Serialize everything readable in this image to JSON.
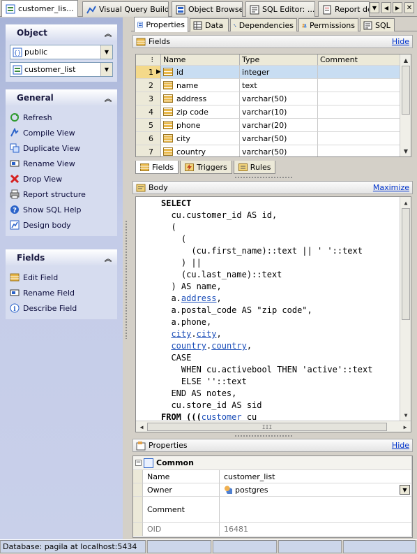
{
  "doc_tabs": [
    {
      "label": "customer_lis...",
      "icon": "view-icon",
      "active": true
    },
    {
      "label": "Visual Query Builder",
      "icon": "query-builder-icon",
      "active": false
    },
    {
      "label": "Object Browser",
      "icon": "object-browser-icon",
      "active": false
    },
    {
      "label": "SQL Editor: ...",
      "icon": "sql-editor-icon",
      "active": false
    },
    {
      "label": "Report des",
      "icon": "report-icon",
      "active": false
    }
  ],
  "left": {
    "object": {
      "title": "Object",
      "schema": "public",
      "view": "customer_list"
    },
    "general": {
      "title": "General",
      "items": [
        "Refresh",
        "Compile View",
        "Duplicate View",
        "Rename View",
        "Drop View",
        "Report structure",
        "Show SQL Help",
        "Design body"
      ]
    },
    "fields": {
      "title": "Fields",
      "items": [
        "Edit Field",
        "Rename Field",
        "Describe Field"
      ]
    }
  },
  "subtabs": [
    "Properties",
    "Data",
    "Dependencies",
    "Permissions",
    "SQL"
  ],
  "fields_section": {
    "title": "Fields",
    "hide_label": "Hide",
    "columns": [
      "Name",
      "Type",
      "Comment"
    ],
    "rows": [
      {
        "num": "1",
        "name": "id",
        "type": "integer",
        "comment": ""
      },
      {
        "num": "2",
        "name": "name",
        "type": "text",
        "comment": ""
      },
      {
        "num": "3",
        "name": "address",
        "type": "varchar(50)",
        "comment": ""
      },
      {
        "num": "4",
        "name": "zip code",
        "type": "varchar(10)",
        "comment": ""
      },
      {
        "num": "5",
        "name": "phone",
        "type": "varchar(20)",
        "comment": ""
      },
      {
        "num": "6",
        "name": "city",
        "type": "varchar(50)",
        "comment": ""
      },
      {
        "num": "7",
        "name": "country",
        "type": "varchar(50)",
        "comment": ""
      }
    ],
    "tabs": [
      "Fields",
      "Triggers",
      "Rules"
    ]
  },
  "body_section": {
    "title": "Body",
    "maximize_label": "Maximize",
    "lines": [
      [
        {
          "t": "SELECT",
          "c": "kw"
        }
      ],
      [
        {
          "t": "  cu.customer_id AS id,",
          "c": ""
        }
      ],
      [
        {
          "t": "  (",
          "c": ""
        }
      ],
      [
        {
          "t": "    (",
          "c": ""
        }
      ],
      [
        {
          "t": "      (cu.first_name)::text || ' '::text",
          "c": ""
        }
      ],
      [
        {
          "t": "    ) ||",
          "c": ""
        }
      ],
      [
        {
          "t": "    (cu.last_name)::text",
          "c": ""
        }
      ],
      [
        {
          "t": "  ) AS name,",
          "c": ""
        }
      ],
      [
        {
          "t": "  a.",
          "c": ""
        },
        {
          "t": "address",
          "c": "lnk"
        },
        {
          "t": ",",
          "c": ""
        }
      ],
      [
        {
          "t": "  a.postal_code AS \"zip code\",",
          "c": ""
        }
      ],
      [
        {
          "t": "  a.phone,",
          "c": ""
        }
      ],
      [
        {
          "t": "  ",
          "c": ""
        },
        {
          "t": "city",
          "c": "lnk"
        },
        {
          "t": ".",
          "c": ""
        },
        {
          "t": "city",
          "c": "lnk"
        },
        {
          "t": ",",
          "c": ""
        }
      ],
      [
        {
          "t": "  ",
          "c": ""
        },
        {
          "t": "country",
          "c": "lnk"
        },
        {
          "t": ".",
          "c": ""
        },
        {
          "t": "country",
          "c": "lnk"
        },
        {
          "t": ",",
          "c": ""
        }
      ],
      [
        {
          "t": "  CASE",
          "c": ""
        }
      ],
      [
        {
          "t": "    WHEN cu.activebool THEN 'active'::text",
          "c": ""
        }
      ],
      [
        {
          "t": "    ELSE ''::text",
          "c": ""
        }
      ],
      [
        {
          "t": "  END AS notes,",
          "c": ""
        }
      ],
      [
        {
          "t": "  cu.store_id AS sid",
          "c": ""
        }
      ],
      [
        {
          "t": "FROM (((",
          "c": "kw"
        },
        {
          "t": "customer",
          "c": "lnk"
        },
        {
          "t": " cu",
          "c": ""
        }
      ]
    ]
  },
  "properties_section": {
    "title": "Properties",
    "hide_label": "Hide",
    "group": "Common",
    "rows": [
      {
        "label": "Name",
        "value": "customer_list"
      },
      {
        "label": "Owner",
        "value": "postgres"
      },
      {
        "label": "Comment",
        "value": ""
      },
      {
        "label": "OID",
        "value": "16481"
      }
    ]
  },
  "status": {
    "database": "Database: pagila at localhost:5434"
  }
}
